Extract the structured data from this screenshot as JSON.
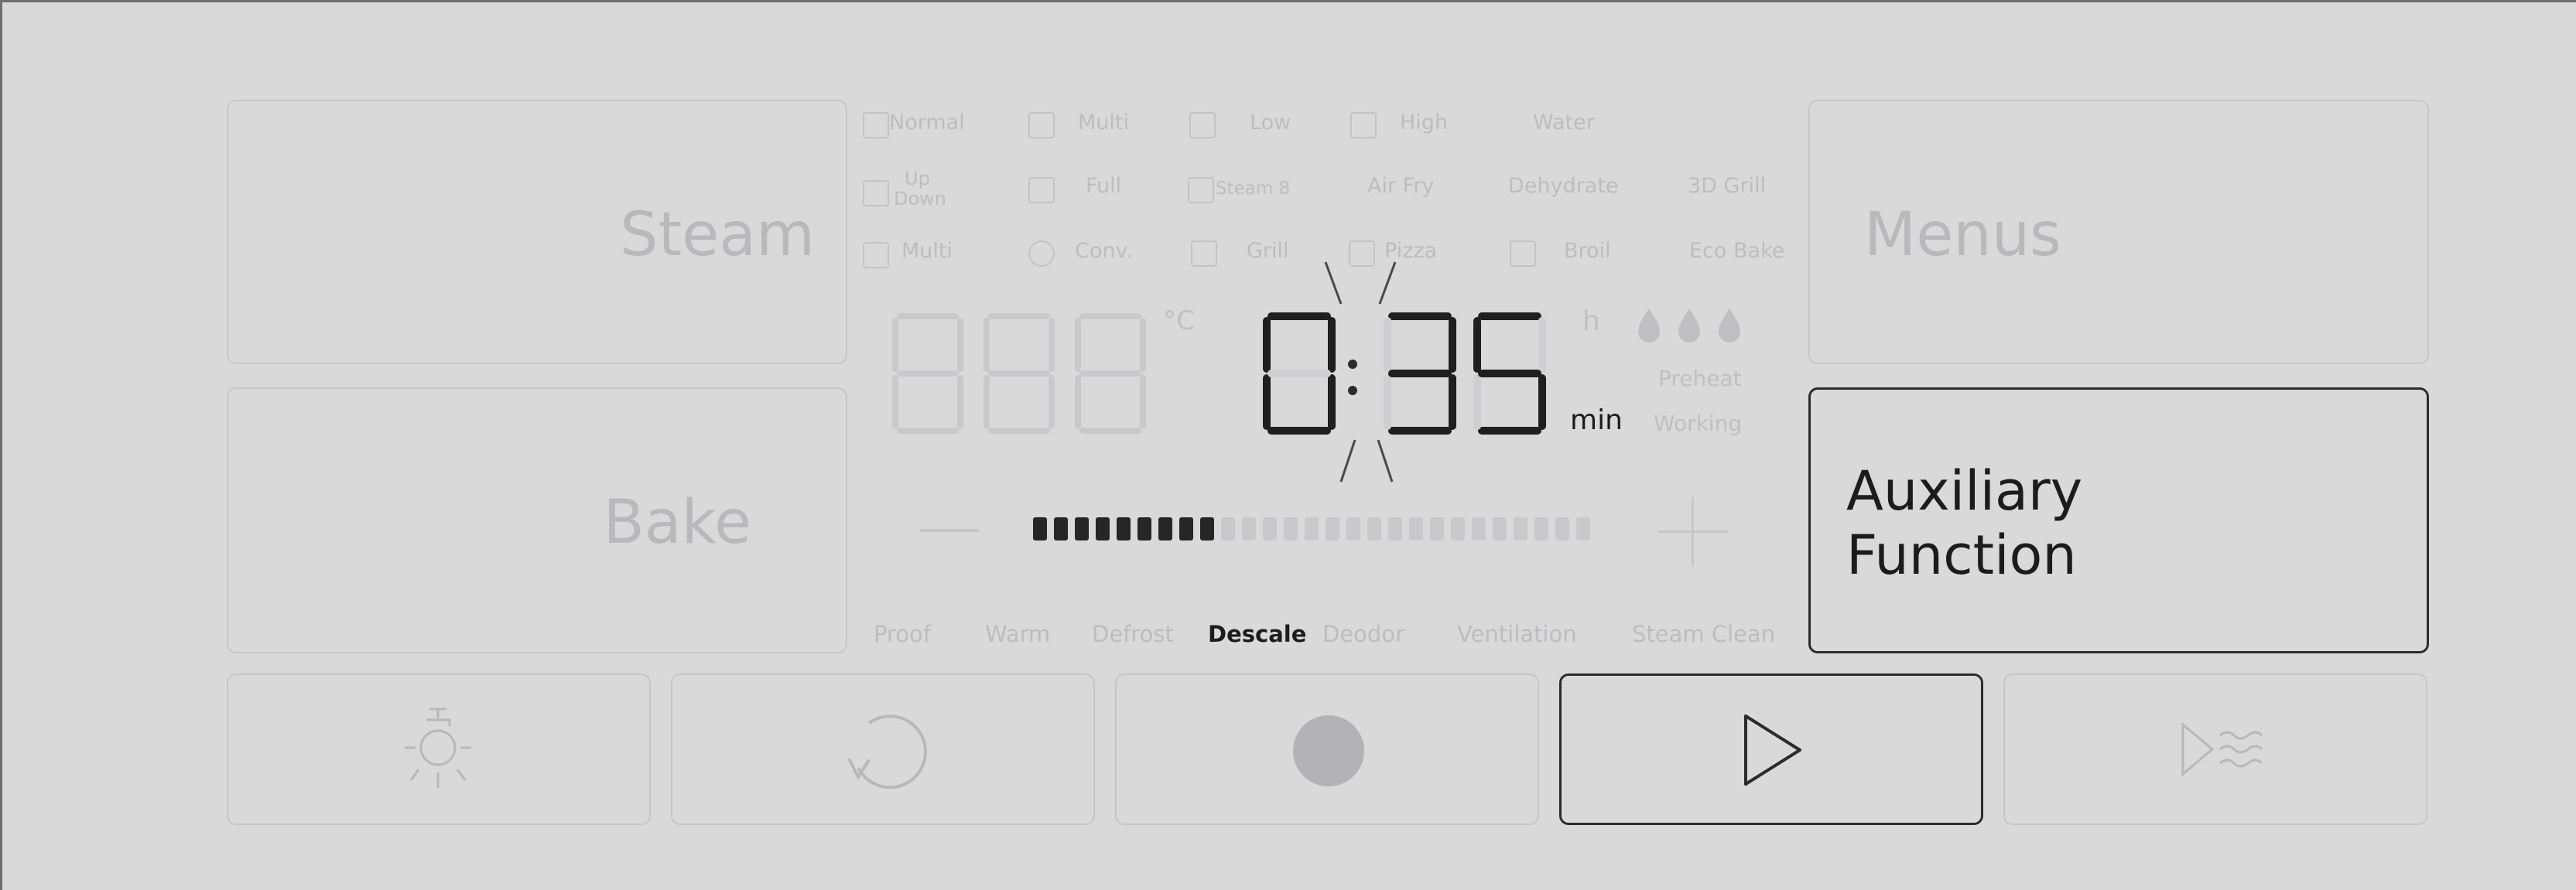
{
  "buttons": {
    "steam": "Steam",
    "bake": "Bake",
    "menus": "Menus",
    "auxiliary_line1": "Auxiliary",
    "auxiliary_line2": "Function"
  },
  "modes": {
    "row1": [
      "Normal",
      "Multi",
      "Low",
      "High",
      "Water"
    ],
    "row2_updown_top": "Up",
    "row2_updown_bottom": "Down",
    "row2": [
      "Full",
      "Steam 8",
      "Air Fry",
      "Dehydrate",
      "3D Grill"
    ],
    "row3": [
      "Multi",
      "Conv.",
      "Grill",
      "Pizza",
      "Broil",
      "Eco Bake"
    ]
  },
  "display": {
    "temperature_unit": "°C",
    "time_value": "0:35",
    "hour_unit": "h",
    "minute_unit": "min",
    "preheat": "Preheat",
    "working": "Working",
    "level_filled_segments": 9,
    "level_total_segments": 27
  },
  "controls": {
    "minus": "—",
    "plus": "+"
  },
  "functions": [
    "Proof",
    "Warm",
    "Defrost",
    "Descale",
    "Deodor",
    "Ventilation",
    "Steam Clean"
  ],
  "active_function": "Descale",
  "bottom_buttons": [
    "light-icon",
    "rotate-icon",
    "record-icon",
    "play-icon",
    "play-steam-icon"
  ],
  "colors": {
    "panel": "#d9d9da",
    "inactive_text": "#bdbdbf",
    "active": "#1c1c1c"
  }
}
